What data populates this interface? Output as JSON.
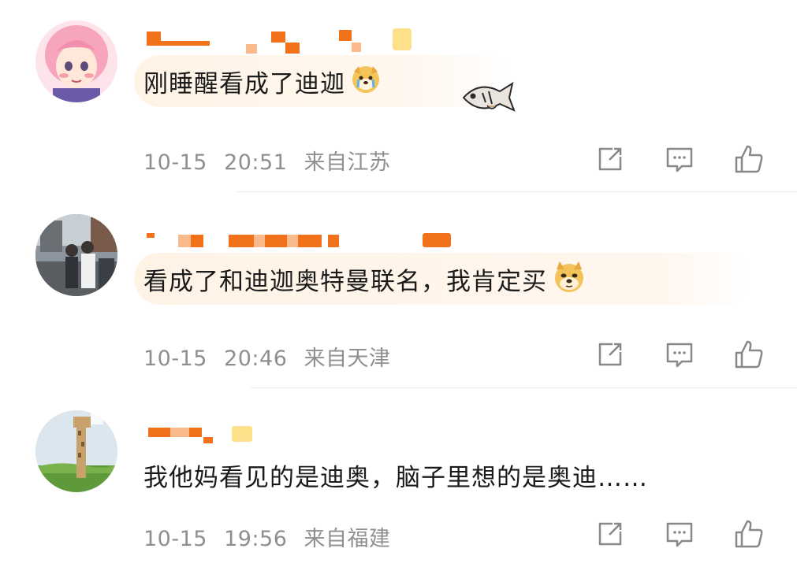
{
  "comments": [
    {
      "text": "刚睡醒看成了迪迦",
      "emoji": "crying-dog-emoji",
      "sticker": "fish-sticker",
      "date": "10-15",
      "time": "20:51",
      "location": "来自江苏",
      "avatar": "anime-girl-avatar"
    },
    {
      "text": "看成了和迪迦奥特曼联名，我肯定买",
      "emoji": "doge-emoji",
      "date": "10-15",
      "time": "20:46",
      "location": "来自天津",
      "avatar": "street-photo-avatar"
    },
    {
      "text": "我他妈看见的是迪奥，脑子里想的是奥迪……",
      "date": "10-15",
      "time": "19:56",
      "location": "来自福建",
      "avatar": "giraffe-avatar"
    }
  ],
  "icons": {
    "share": "share-icon",
    "reply": "comment-icon",
    "like": "thumbs-up-icon"
  },
  "colors": {
    "username_pixel": "#f2721c",
    "username_pixel_light": "#f9b98a",
    "vip_badge": "#ffcf33",
    "highlight": "#fff2e3",
    "meta_text": "#8f8f8f",
    "icon": "#888888"
  }
}
